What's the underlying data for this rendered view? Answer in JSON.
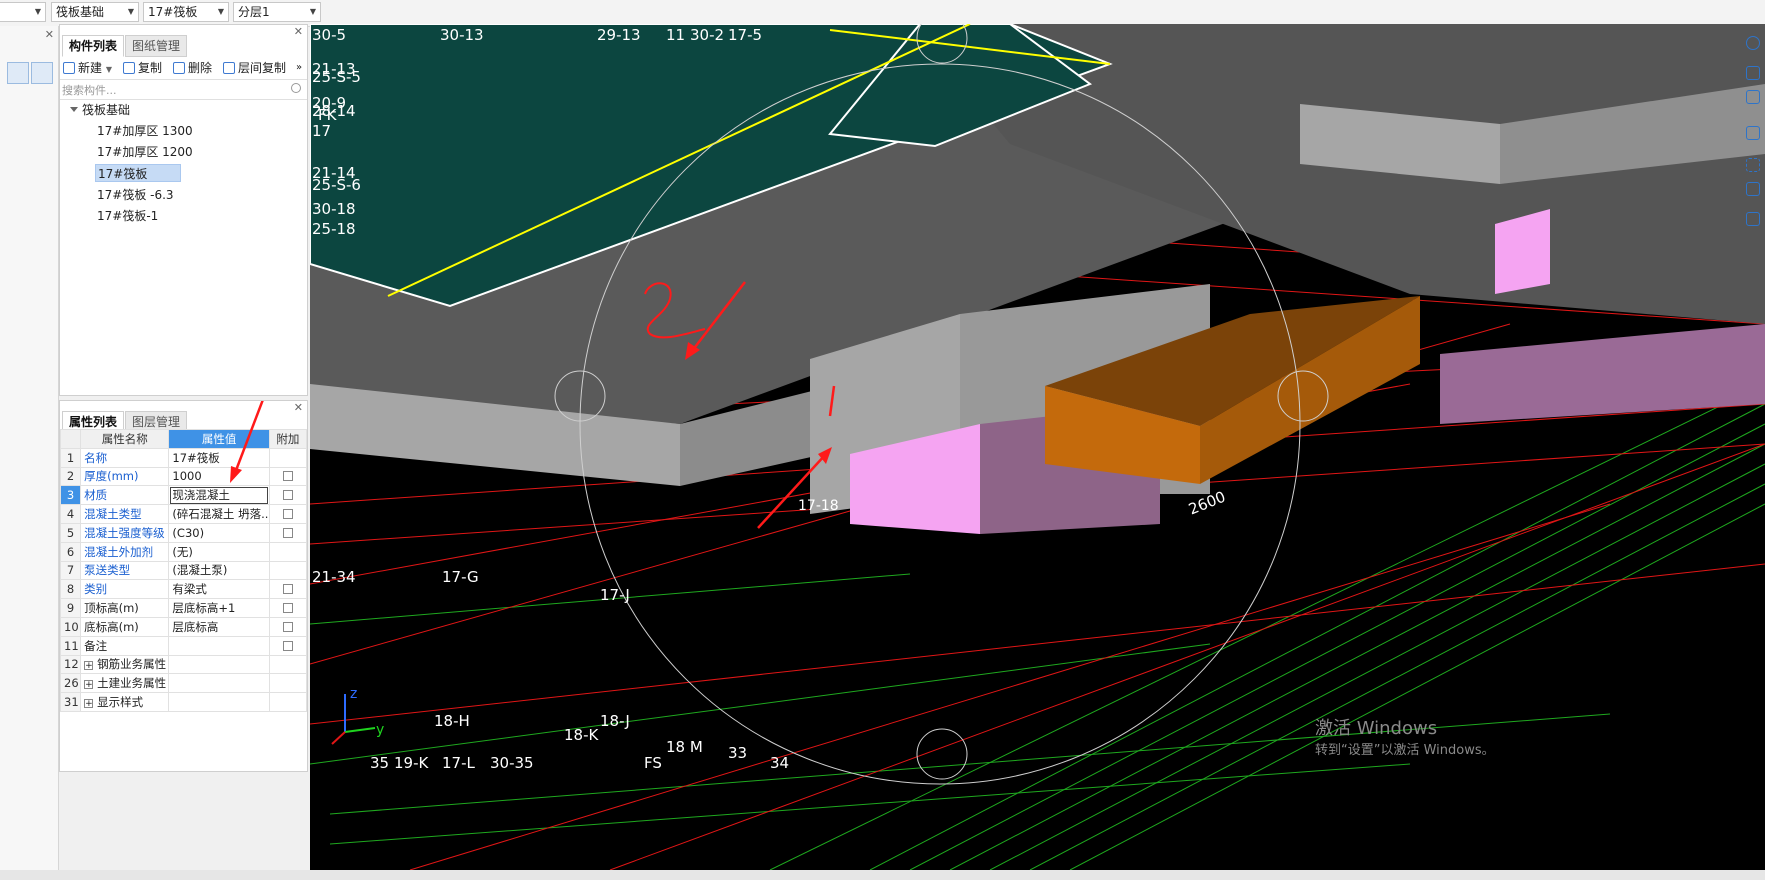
{
  "topbar": {
    "combos": [
      "",
      "筏板基础",
      "17#筏板",
      "分层1"
    ]
  },
  "list_panel": {
    "tabs": [
      "构件列表",
      "图纸管理"
    ],
    "toolbar": {
      "new": "新建",
      "copy": "复制",
      "delete": "删除",
      "floor_copy": "层间复制"
    },
    "search_placeholder": "搜索构件...",
    "tree": {
      "root": "筏板基础",
      "items": [
        "17#加厚区 1300",
        "17#加厚区 1200",
        "17#筏板",
        "17#筏板 -6.3",
        "17#筏板-1"
      ]
    }
  },
  "props_panel": {
    "tabs": [
      "属性列表",
      "图层管理"
    ],
    "headers": {
      "name": "属性名称",
      "value": "属性值",
      "extra": "附加"
    },
    "rows": [
      {
        "num": "1",
        "name": "名称",
        "value": "17#筏板"
      },
      {
        "num": "2",
        "name": "厚度(mm)",
        "value": "1000"
      },
      {
        "num": "3",
        "name": "材质",
        "value": "现浇混凝土"
      },
      {
        "num": "4",
        "name": "混凝土类型",
        "value": "(碎石混凝土 坍落..."
      },
      {
        "num": "5",
        "name": "混凝土强度等级",
        "value": "(C30)"
      },
      {
        "num": "6",
        "name": "混凝土外加剂",
        "value": "(无)"
      },
      {
        "num": "7",
        "name": "泵送类型",
        "value": "(混凝土泵)"
      },
      {
        "num": "8",
        "name": "类别",
        "value": "有梁式"
      },
      {
        "num": "9",
        "name": "顶标高(m)",
        "value": "层底标高+1"
      },
      {
        "num": "10",
        "name": "底标高(m)",
        "value": "层底标高"
      },
      {
        "num": "11",
        "name": "备注",
        "value": ""
      },
      {
        "num": "12",
        "name": "钢筋业务属性",
        "value": ""
      },
      {
        "num": "26",
        "name": "土建业务属性",
        "value": ""
      },
      {
        "num": "31",
        "name": "显示样式",
        "value": ""
      }
    ]
  },
  "viewport": {
    "labels": [
      "30-5",
      "30-13",
      "29-13",
      "11",
      "30-2",
      "17-5",
      "21-13",
      "25-S-5",
      "20-9",
      "28-14",
      "FK",
      "17",
      "21-14",
      "25-S-6",
      "30-18",
      "25-18",
      "17-G",
      "17-J",
      "17-18",
      "2600",
      "18-H",
      "18-J",
      "18-K",
      "18 M",
      "33",
      "FS",
      "35",
      "19-K",
      "17-L",
      "30-35",
      "34",
      "21-34",
      "2",
      "y",
      "z"
    ],
    "watermark_title": "激活 Windows",
    "watermark_sub": "转到“设置”以激活 Windows。"
  },
  "colors": {
    "accent": "#3f92e6",
    "slab": "#5a5a5a",
    "teal": "#0c4640",
    "orange": "#c46a0c",
    "pink": "#f5a4f2"
  }
}
